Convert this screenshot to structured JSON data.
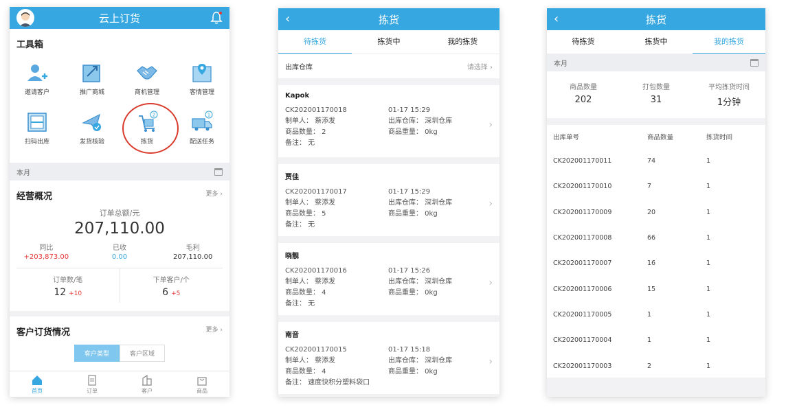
{
  "home": {
    "title": "云上订货",
    "toolbox_title": "工具箱",
    "tools": [
      {
        "label": "邀请客户",
        "icon": "invite-customer-icon"
      },
      {
        "label": "推广商城",
        "icon": "promote-mall-icon"
      },
      {
        "label": "商机管理",
        "icon": "handshake-icon"
      },
      {
        "label": "客情管理",
        "icon": "map-pin-icon"
      },
      {
        "label": "扫码出库",
        "icon": "scan-icon"
      },
      {
        "label": "发货核验",
        "icon": "plane-check-icon"
      },
      {
        "label": "拣货",
        "icon": "cart-icon",
        "badge": "2"
      },
      {
        "label": "配送任务",
        "icon": "truck-icon",
        "badge": "1"
      }
    ],
    "period": "本月",
    "overview": {
      "title": "经营概况",
      "more": "更多",
      "total_label": "订单总额/元",
      "total_value": "207,110.00",
      "metrics": [
        {
          "label": "同比",
          "value": "+203,873.00",
          "color": "#e53935"
        },
        {
          "label": "已收",
          "value": "0.00",
          "color": "#36a7e0"
        },
        {
          "label": "毛利",
          "value": "207,110.00",
          "color": "#333333"
        }
      ],
      "orders_label": "订单数/笔",
      "orders_value": "12",
      "orders_delta": "+10",
      "customers_label": "下单客户/个",
      "customers_value": "6",
      "customers_delta": "+5"
    },
    "customer_orders": {
      "title": "客户订货情况",
      "more": "更多",
      "segments": [
        "客户类型",
        "客户区域"
      ]
    },
    "nav": [
      "首页",
      "订单",
      "客户",
      "商品"
    ]
  },
  "picking": {
    "title": "拣货",
    "tabs": [
      "待拣货",
      "拣货中",
      "我的拣货"
    ],
    "warehouse_label": "出库仓库",
    "warehouse_placeholder": "请选择",
    "orders": [
      {
        "name": "Kapok",
        "no": "CK202001170018",
        "time": "01-17 15:29",
        "maker": "制单人： 蔡添发",
        "warehouse": "出库仓库： 深圳仓库",
        "qty": "商品数量： 2",
        "weight": "商品重量： 0kg",
        "note": "备注： 无"
      },
      {
        "name": "贾佳",
        "no": "CK202001170017",
        "time": "01-17 15:29",
        "maker": "制单人： 蔡添发",
        "warehouse": "出库仓库： 深圳仓库",
        "qty": "商品数量： 5",
        "weight": "商品重量： 0kg",
        "note": "备注： 无"
      },
      {
        "name": "晓靓",
        "no": "CK202001170016",
        "time": "01-17 15:26",
        "maker": "制单人： 蔡添发",
        "warehouse": "出库仓库： 深圳仓库",
        "qty": "商品数量： 4",
        "weight": "商品重量： 0kg",
        "note": "备注： 无"
      },
      {
        "name": "南音",
        "no": "CK202001170015",
        "time": "01-17 15:18",
        "maker": "制单人： 蔡添发",
        "warehouse": "出库仓库： 深圳仓库",
        "qty": "商品数量： 4",
        "weight": "商品重量： 0kg",
        "note": "备注： 速度快积分塑料袋口"
      }
    ]
  },
  "mypicking": {
    "title": "拣货",
    "tabs": [
      "待拣货",
      "拣货中",
      "我的拣货"
    ],
    "period": "本月",
    "stats": [
      {
        "label": "商品数量",
        "value": "202"
      },
      {
        "label": "打包数量",
        "value": "31"
      },
      {
        "label": "平均拣货时间",
        "value": "1分钟"
      }
    ],
    "columns": [
      "出库单号",
      "商品数量",
      "拣货时间"
    ],
    "rows": [
      [
        "CK202001170011",
        "74",
        "1"
      ],
      [
        "CK202001170010",
        "7",
        "1"
      ],
      [
        "CK202001170009",
        "20",
        "1"
      ],
      [
        "CK202001170008",
        "66",
        "1"
      ],
      [
        "CK202001170007",
        "16",
        "1"
      ],
      [
        "CK202001170006",
        "15",
        "1"
      ],
      [
        "CK202001170005",
        "1",
        "1"
      ],
      [
        "CK202001170004",
        "1",
        "1"
      ],
      [
        "CK202001170003",
        "2",
        "1"
      ]
    ]
  }
}
